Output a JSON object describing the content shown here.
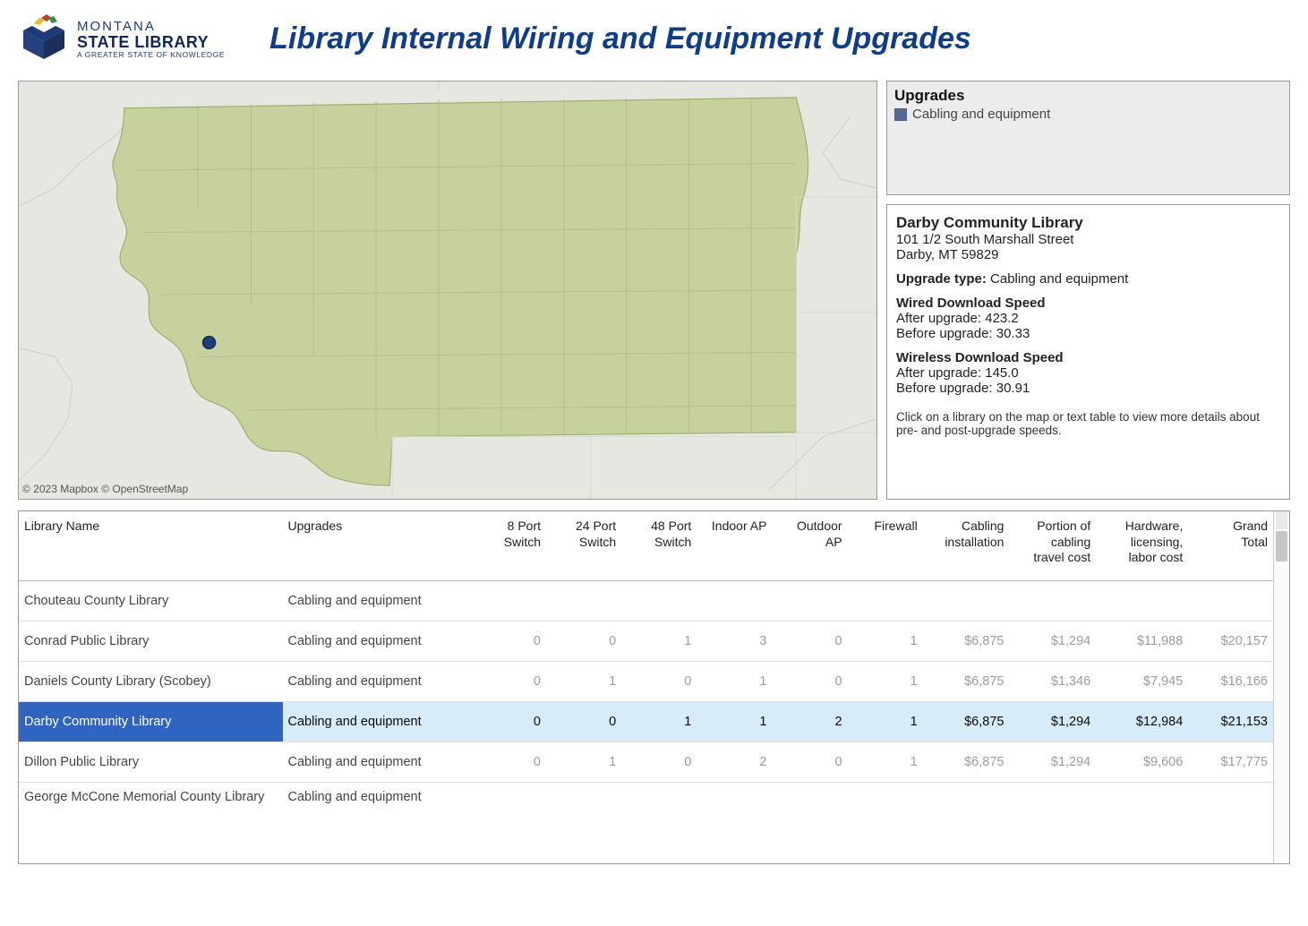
{
  "header": {
    "logo_line1": "MONTANA",
    "logo_line2": "STATE LIBRARY",
    "logo_tagline": "A GREATER STATE OF KNOWLEDGE",
    "title": "Library Internal Wiring and Equipment Upgrades"
  },
  "map": {
    "attribution": "© 2023 Mapbox © OpenStreetMap"
  },
  "legend": {
    "title": "Upgrades",
    "items": [
      {
        "label": "Cabling and equipment",
        "swatch": "#536a95"
      }
    ]
  },
  "detail": {
    "library_name": "Darby Community Library",
    "address_line1": "101 1/2 South Marshall Street",
    "address_line2": "Darby, MT 59829",
    "upgrade_type_label": "Upgrade type:",
    "upgrade_type_value": " Cabling and equipment",
    "wired_head": "Wired Download Speed",
    "wired_after_label": "After upgrade: ",
    "wired_after_value": "423.2",
    "wired_before_label": "Before upgrade: ",
    "wired_before_value": "30.33",
    "wireless_head": "Wireless Download Speed",
    "wireless_after_label": "After upgrade: ",
    "wireless_after_value": "145.0",
    "wireless_before_label": "Before upgrade: ",
    "wireless_before_value": "30.91",
    "hint": "Click on a library on the map or text table to view more details about pre- and post-upgrade speeds."
  },
  "table": {
    "headers": {
      "library": "Library Name",
      "upgrades": "Upgrades",
      "p8": "8 Port\nSwitch",
      "p24": "24 Port\nSwitch",
      "p48": "48 Port\nSwitch",
      "iap": "Indoor AP",
      "oap": "Outdoor AP",
      "fw": "Firewall",
      "cab": "Cabling\ninstallation",
      "trav": "Portion of\ncabling\ntravel cost",
      "hw": "Hardware,\nlicensing,\nlabor cost",
      "gt": "Grand\nTotal"
    },
    "rows": [
      {
        "library": "Chouteau County Library",
        "upgrades": "Cabling and equipment",
        "p8": "",
        "p24": "",
        "p48": "",
        "iap": "",
        "oap": "",
        "fw": "",
        "cab": "",
        "trav": "",
        "hw": "",
        "gt": ""
      },
      {
        "library": "Conrad Public Library",
        "upgrades": "Cabling and equipment",
        "p8": "0",
        "p24": "0",
        "p48": "1",
        "iap": "3",
        "oap": "0",
        "fw": "1",
        "cab": "$6,875",
        "trav": "$1,294",
        "hw": "$11,988",
        "gt": "$20,157"
      },
      {
        "library": "Daniels County Library (Scobey)",
        "upgrades": "Cabling and equipment",
        "p8": "0",
        "p24": "1",
        "p48": "0",
        "iap": "1",
        "oap": "0",
        "fw": "1",
        "cab": "$6,875",
        "trav": "$1,346",
        "hw": "$7,945",
        "gt": "$16,166"
      },
      {
        "library": "Darby Community Library",
        "upgrades": "Cabling and equipment",
        "p8": "0",
        "p24": "0",
        "p48": "1",
        "iap": "1",
        "oap": "2",
        "fw": "1",
        "cab": "$6,875",
        "trav": "$1,294",
        "hw": "$12,984",
        "gt": "$21,153",
        "selected": true
      },
      {
        "library": "Dillon Public Library",
        "upgrades": "Cabling and equipment",
        "p8": "0",
        "p24": "1",
        "p48": "0",
        "iap": "2",
        "oap": "0",
        "fw": "1",
        "cab": "$6,875",
        "trav": "$1,294",
        "hw": "$9,606",
        "gt": "$17,775"
      },
      {
        "library": "George McCone Memorial County Library",
        "upgrades": "Cabling and equipment",
        "p8": "",
        "p24": "",
        "p48": "",
        "iap": "",
        "oap": "",
        "fw": "",
        "cab": "",
        "trav": "",
        "hw": "",
        "gt": "",
        "partial": true
      }
    ]
  }
}
